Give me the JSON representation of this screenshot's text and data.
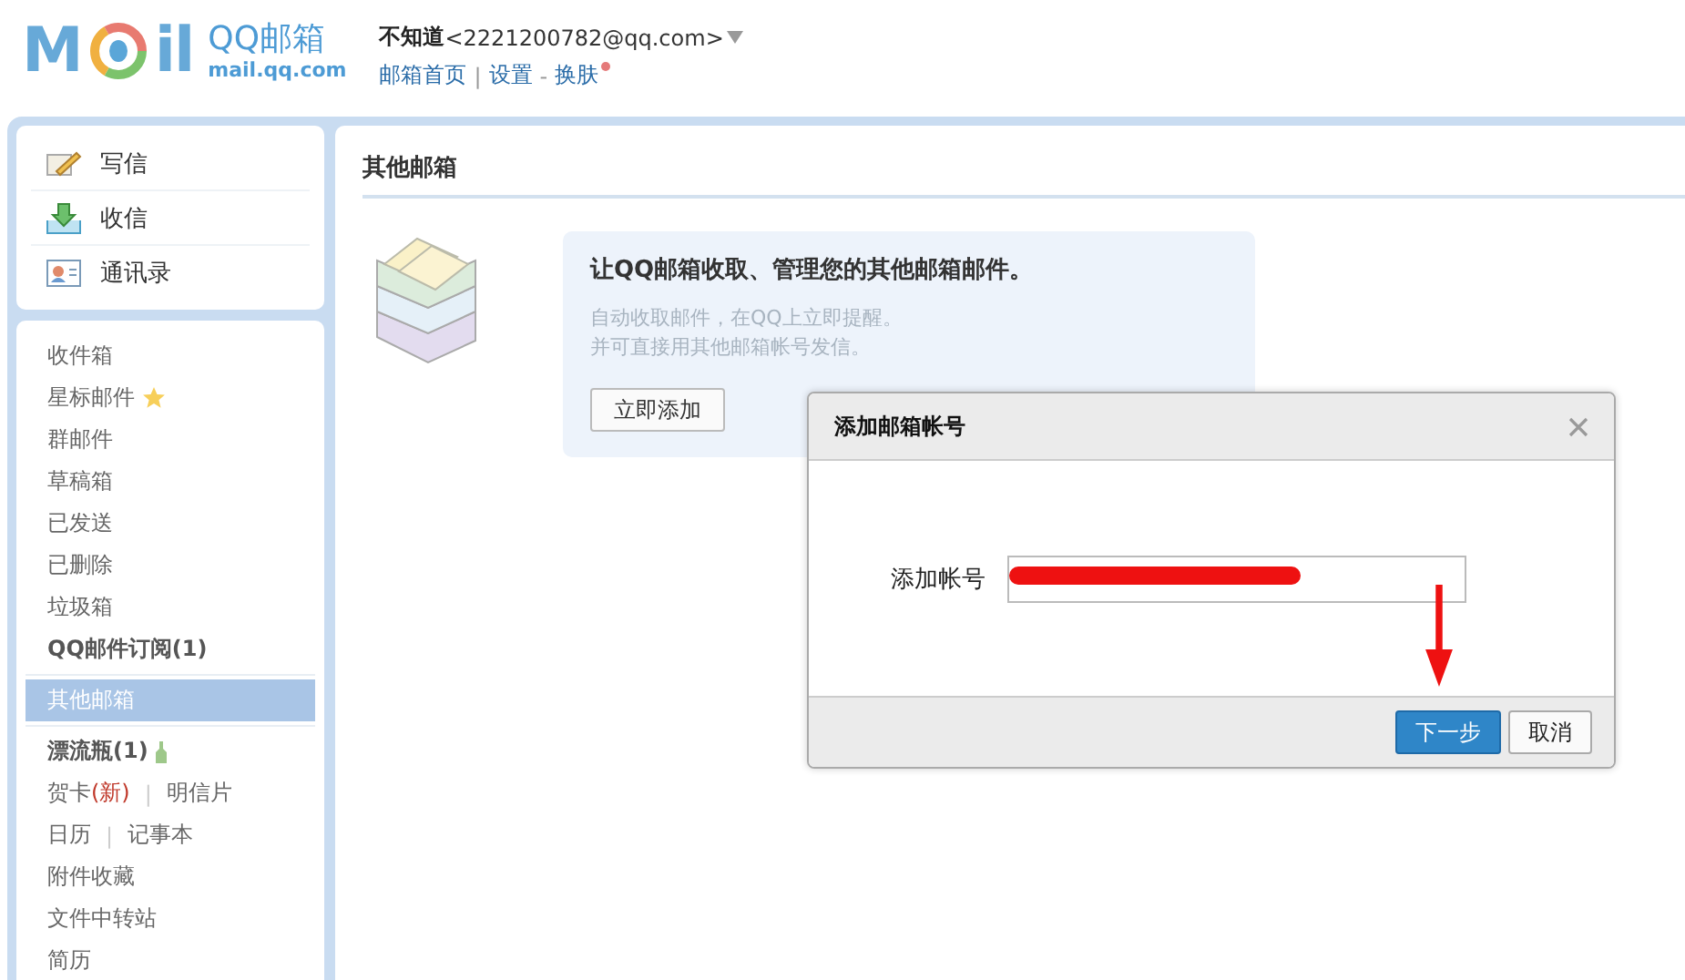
{
  "header": {
    "logo": {
      "left": "M",
      "right": "il",
      "name": "QQ邮箱",
      "domain": "mail.qq.com"
    },
    "account": {
      "name": "不知道",
      "email": "<2221200782@qq.com>"
    },
    "links": [
      {
        "label": "邮箱首页",
        "badge": false
      },
      {
        "label": "设置",
        "separator": "|",
        "badge": false
      },
      {
        "label": "换肤",
        "separator": "-",
        "badge": true
      }
    ]
  },
  "sidebar": {
    "actions": [
      {
        "label": "写信",
        "kind": "write"
      },
      {
        "label": "收信",
        "kind": "receive"
      },
      {
        "label": "通讯录",
        "kind": "contacts"
      }
    ],
    "groups": [
      [
        {
          "links": [
            {
              "label": "收件箱"
            }
          ],
          "selected": false,
          "bold": false,
          "kind": "plain"
        },
        {
          "links": [
            {
              "label": "星标邮件"
            }
          ],
          "selected": false,
          "bold": false,
          "kind": "starred"
        },
        {
          "links": [
            {
              "label": "群邮件"
            }
          ],
          "selected": false,
          "bold": false,
          "kind": "plain"
        },
        {
          "links": [
            {
              "label": "草稿箱"
            }
          ],
          "selected": false,
          "bold": false,
          "kind": "plain"
        },
        {
          "links": [
            {
              "label": "已发送"
            }
          ],
          "selected": false,
          "bold": false,
          "kind": "plain"
        },
        {
          "links": [
            {
              "label": "已删除"
            }
          ],
          "selected": false,
          "bold": false,
          "kind": "plain"
        },
        {
          "links": [
            {
              "label": "垃圾箱"
            }
          ],
          "selected": false,
          "bold": false,
          "kind": "plain"
        },
        {
          "links": [
            {
              "label": "QQ邮件订阅(1)"
            }
          ],
          "selected": false,
          "bold": true,
          "kind": "plain"
        }
      ],
      [
        {
          "links": [
            {
              "label": "其他邮箱"
            }
          ],
          "selected": true,
          "bold": false,
          "kind": "plain"
        }
      ],
      [
        {
          "links": [
            {
              "label": "漂流瓶(1)"
            }
          ],
          "selected": false,
          "bold": true,
          "kind": "bottle"
        },
        {
          "links": [
            {
              "label": "贺卡",
              "note": "(新)"
            },
            {
              "label": "明信片",
              "separator": "|"
            }
          ],
          "selected": false,
          "bold": false,
          "kind": "plain"
        },
        {
          "links": [
            {
              "label": "日历"
            },
            {
              "label": "记事本",
              "separator": "|"
            }
          ],
          "selected": false,
          "bold": false,
          "kind": "plain"
        },
        {
          "links": [
            {
              "label": "附件收藏"
            }
          ],
          "selected": false,
          "bold": false,
          "kind": "plain"
        },
        {
          "links": [
            {
              "label": "文件中转站"
            }
          ],
          "selected": false,
          "bold": false,
          "kind": "plain"
        },
        {
          "links": [
            {
              "label": "简历"
            }
          ],
          "selected": false,
          "bold": false,
          "kind": "plain"
        }
      ]
    ]
  },
  "main": {
    "title": "其他邮箱",
    "promo": {
      "heading": "让QQ邮箱收取、管理您的其他邮箱邮件。",
      "lines": [
        "自动收取邮件，在QQ上立即提醒。",
        "并可直接用其他邮箱帐号发信。"
      ],
      "button": "立即添加"
    }
  },
  "dialog": {
    "title": "添加邮箱帐号",
    "field_label": "添加帐号",
    "buttons": [
      {
        "label": "下一步",
        "primary": true
      },
      {
        "label": "取消",
        "primary": false
      }
    ]
  }
}
